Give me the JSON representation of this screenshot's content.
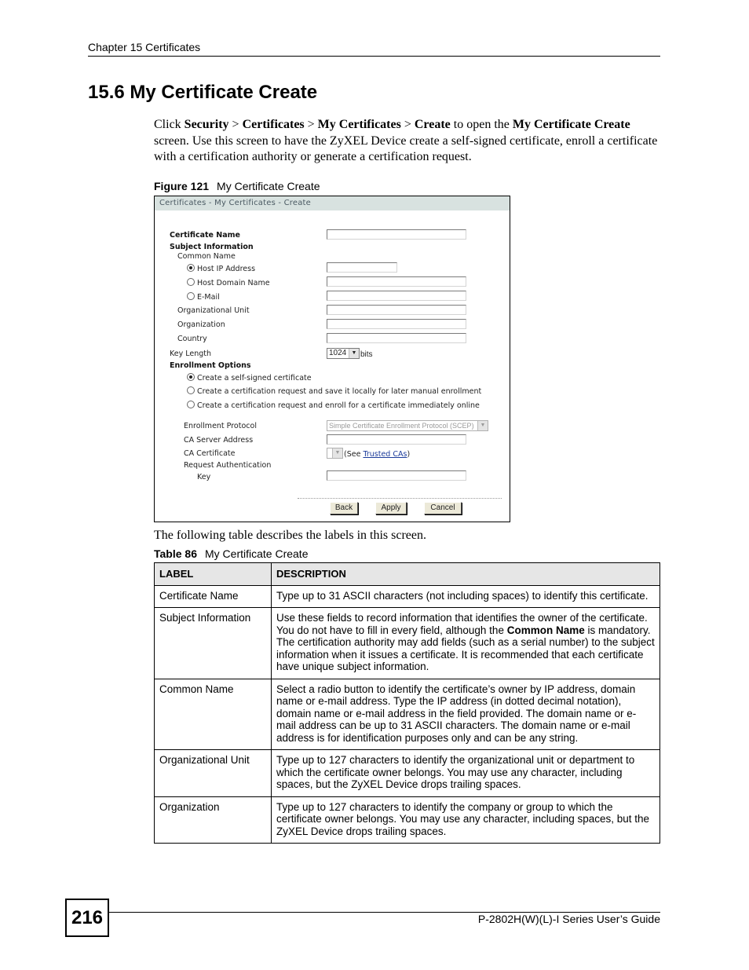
{
  "header": {
    "chapter": "Chapter 15 Certificates",
    "section_title": "15.6  My Certificate Create"
  },
  "intro": {
    "click": "Click ",
    "path": [
      "Security",
      "Certificates",
      "My Certificates",
      "Create"
    ],
    "sep": " > ",
    "to_open": " to open the ",
    "screen_name": "My Certificate Create",
    "rest": " screen. Use this screen to have the ZyXEL Device create a self-signed certificate, enroll a certificate with a certification authority or generate a certification request."
  },
  "figure": {
    "number": "Figure 121",
    "caption": "My Certificate Create",
    "screen": {
      "title": "Certificates - My Certificates - Create",
      "certificate_name_label": "Certificate Name",
      "certificate_name_value": "",
      "subject_information_label": "Subject Information",
      "common_name_label": "Common Name",
      "common_name_options": [
        {
          "label": "Host IP Address",
          "selected": true,
          "value": ""
        },
        {
          "label": "Host Domain Name",
          "selected": false,
          "value": ""
        },
        {
          "label": "E-Mail",
          "selected": false,
          "value": ""
        }
      ],
      "organizational_unit_label": "Organizational Unit",
      "organizational_unit_value": "",
      "organization_label": "Organization",
      "organization_value": "",
      "country_label": "Country",
      "country_value": "",
      "key_length_label": "Key Length",
      "key_length_value": "1024",
      "key_length_unit": "bits",
      "enrollment_options_label": "Enrollment Options",
      "enrollment_options": [
        {
          "label": "Create a self-signed certificate",
          "selected": true
        },
        {
          "label": "Create a certification request and save it locally for later manual enrollment",
          "selected": false
        },
        {
          "label": "Create a certification request and enroll for a certificate immediately online",
          "selected": false
        }
      ],
      "enrollment_protocol_label": "Enrollment Protocol",
      "enrollment_protocol_value": "Simple Certificate Enrollment Protocol (SCEP)",
      "ca_server_address_label": "CA Server Address",
      "ca_server_address_value": "",
      "ca_certificate_label": "CA Certificate",
      "ca_certificate_value": "",
      "see_prefix": "(See ",
      "trusted_cas_link": "Trusted CAs",
      "see_suffix": ")",
      "request_authentication_label": "Request Authentication",
      "key_label": "Key",
      "key_value": "",
      "buttons": {
        "back": "Back",
        "apply": "Apply",
        "cancel": "Cancel"
      }
    }
  },
  "after_figure": "The following table describes the labels in this screen.",
  "table": {
    "number": "Table 86",
    "caption": "My Certificate Create",
    "headers": [
      "LABEL",
      "DESCRIPTION"
    ],
    "rows": [
      {
        "label": "Certificate Name",
        "description": "Type up to 31 ASCII characters (not including spaces) to identify this certificate."
      },
      {
        "label": "Subject Information",
        "desc_before": "Use these fields to record information that identifies the owner of the certificate. You do not have to fill in every field, although the ",
        "desc_bold": "Common Name",
        "desc_after": " is mandatory. The certification authority may add fields (such as a serial number) to the subject information when it issues a certificate. It is recommended that each certificate have unique subject information."
      },
      {
        "label": "Common Name",
        "description": "Select a radio button to identify the certificate’s owner by IP address, domain name or e-mail address. Type the IP address (in dotted decimal notation), domain name or e-mail address in the field provided. The domain name or e-mail address can be up to 31 ASCII characters. The domain name or e-mail address is for identification purposes only and can be any string."
      },
      {
        "label": "Organizational Unit",
        "description": "Type up to 127 characters to identify the organizational unit or department to which the certificate owner belongs. You may use any character, including spaces, but the ZyXEL Device drops trailing spaces."
      },
      {
        "label": "Organization",
        "description": "Type up to 127 characters to identify the company or group to which the certificate owner belongs. You may use any character, including spaces, but the ZyXEL Device drops trailing spaces."
      }
    ]
  },
  "footer": {
    "page_number": "216",
    "guide_title": "P-2802H(W)(L)-I Series User’s Guide"
  }
}
